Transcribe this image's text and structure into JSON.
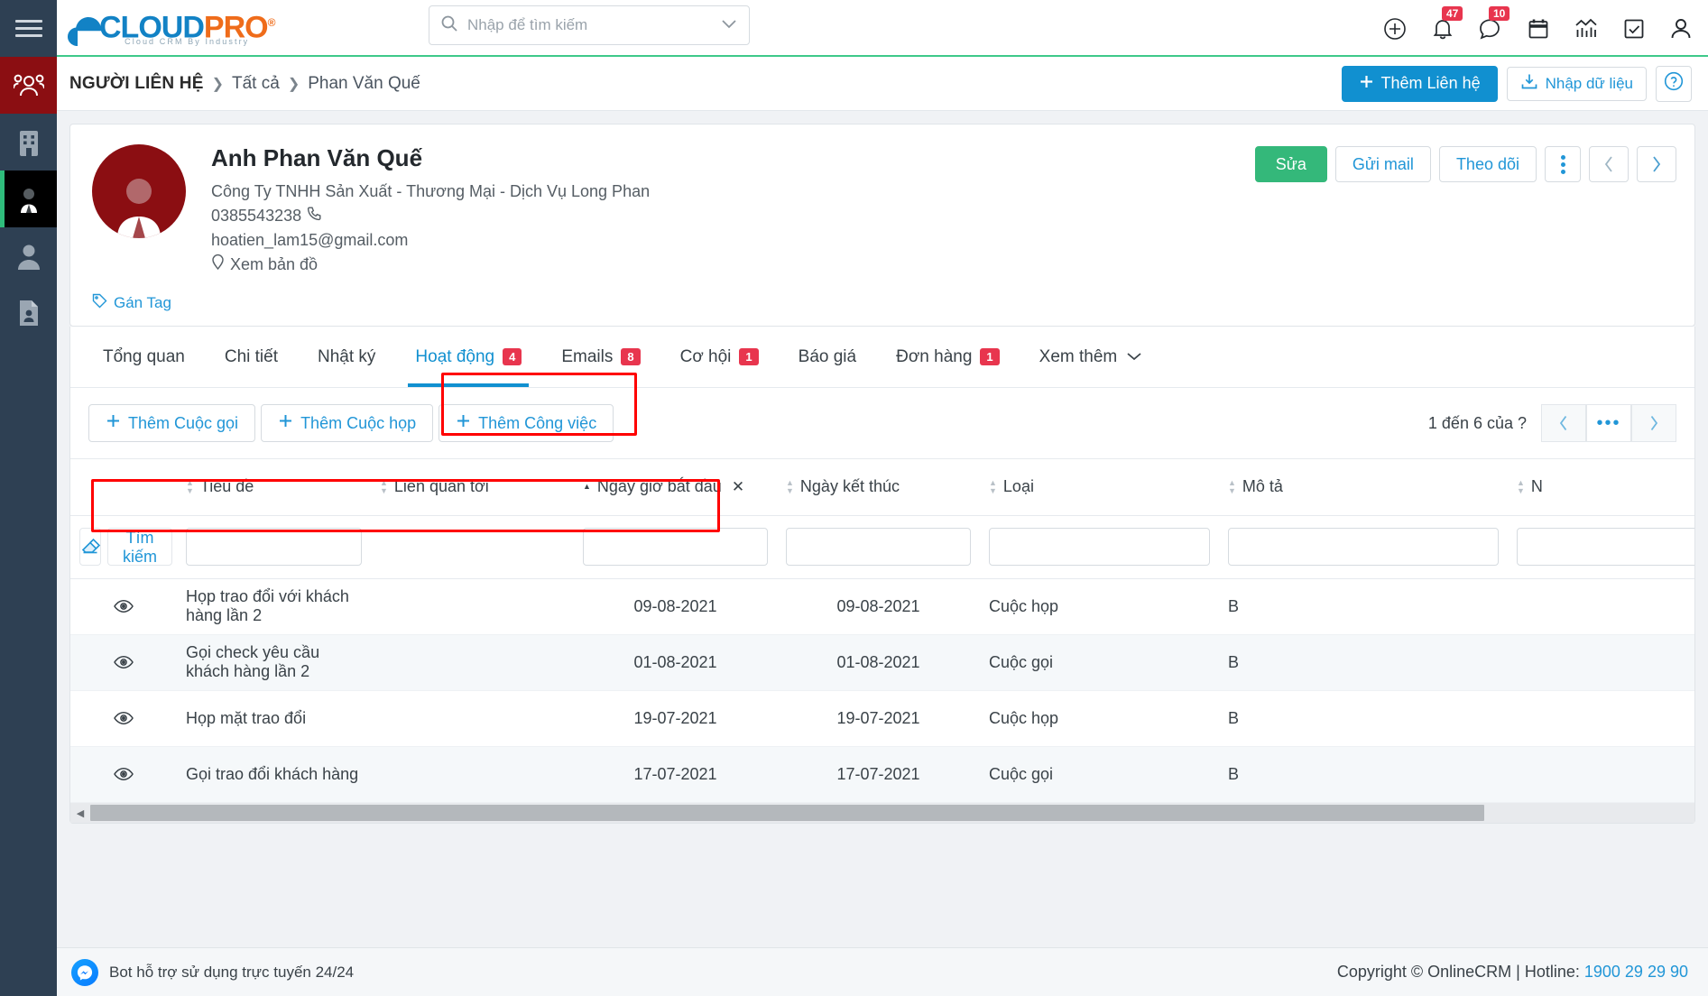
{
  "rail": {
    "menu_icon": "hamburger-menu-icon",
    "items": [
      {
        "name": "contacts",
        "icon": "people-group-icon",
        "state": "highlighted"
      },
      {
        "name": "companies",
        "icon": "building-icon",
        "state": "normal"
      },
      {
        "name": "persons",
        "icon": "businessman-icon",
        "state": "active"
      },
      {
        "name": "leads",
        "icon": "user-icon",
        "state": "normal"
      },
      {
        "name": "documents",
        "icon": "document-user-icon",
        "state": "normal"
      }
    ]
  },
  "topbar": {
    "logo": {
      "cloud": "CLOUD",
      "pro": "PRO",
      "registered": "®",
      "subtitle": "Cloud CRM By Industry"
    },
    "search": {
      "placeholder": "Nhập để tìm kiếm",
      "value": "",
      "icon": "search-icon",
      "dropdown_icon": "chevron-down-icon"
    },
    "icons": [
      {
        "name": "add-circle-icon",
        "badge": ""
      },
      {
        "name": "bell-icon",
        "badge": "47"
      },
      {
        "name": "chat-bubble-icon",
        "badge": "10"
      },
      {
        "name": "calendar-icon",
        "badge": ""
      },
      {
        "name": "analytics-chart-icon",
        "badge": ""
      },
      {
        "name": "checkbox-task-icon",
        "badge": ""
      },
      {
        "name": "user-account-icon",
        "badge": ""
      }
    ]
  },
  "breadcrumb": {
    "root": "NGƯỜI LIÊN HỆ",
    "separator": "❯",
    "all": "Tất cả",
    "current": "Phan Văn Quế",
    "add_contact": "Thêm Liên hệ",
    "import": "Nhập dữ liệu",
    "help": "?"
  },
  "contact": {
    "name": "Anh Phan Văn Quế",
    "company": "Công Ty TNHH Sản Xuất - Thương Mại - Dịch Vụ Long Phan",
    "phone": "0385543238",
    "email": "hoatien_lam15@gmail.com",
    "map_label": "Xem bản đồ",
    "tag_label": "Gán Tag",
    "actions": {
      "edit": "Sửa",
      "send_mail": "Gửi mail",
      "follow": "Theo dõi",
      "more": "more-vertical-icon",
      "prev": "‹",
      "next": "›"
    }
  },
  "tabs": [
    {
      "label": "Tổng quan",
      "badge": "",
      "active": false
    },
    {
      "label": "Chi tiết",
      "badge": "",
      "active": false
    },
    {
      "label": "Nhật ký",
      "badge": "",
      "active": false
    },
    {
      "label": "Hoạt động",
      "badge": "4",
      "active": true
    },
    {
      "label": "Emails",
      "badge": "8",
      "active": false
    },
    {
      "label": "Cơ hội",
      "badge": "1",
      "active": false
    },
    {
      "label": "Báo giá",
      "badge": "",
      "active": false
    },
    {
      "label": "Đơn hàng",
      "badge": "1",
      "active": false
    },
    {
      "label": "Xem thêm",
      "badge": "",
      "active": false
    }
  ],
  "toolbar": {
    "add_call": "Thêm Cuộc gọi",
    "add_meeting": "Thêm Cuộc họp",
    "add_task": "Thêm Công việc",
    "pager_label": "1 đến 6 của ?",
    "pager_prev": "‹",
    "pager_mid": "•••",
    "pager_next": "›"
  },
  "table": {
    "columns": [
      {
        "key": "eye",
        "label": "",
        "sortable": false
      },
      {
        "key": "title",
        "label": "Tiêu đề",
        "sortable": true,
        "sorted": ""
      },
      {
        "key": "related",
        "label": "Liên quan tới",
        "sortable": true,
        "sorted": ""
      },
      {
        "key": "start",
        "label": "Ngày giờ bắt đầu",
        "sortable": true,
        "sorted": "asc",
        "clearable": true
      },
      {
        "key": "end",
        "label": "Ngày kết thúc",
        "sortable": true,
        "sorted": ""
      },
      {
        "key": "type",
        "label": "Loại",
        "sortable": true,
        "sorted": ""
      },
      {
        "key": "desc",
        "label": "Mô tả",
        "sortable": true,
        "sorted": ""
      },
      {
        "key": "more",
        "label": "N",
        "sortable": true,
        "sorted": ""
      }
    ],
    "filter": {
      "eraser_icon": "eraser-icon",
      "search_button": "Tìm kiếm",
      "title_value": "",
      "start_value": "",
      "end_value": "",
      "type_value": "",
      "desc_value": "",
      "more_value": ""
    },
    "rows": [
      {
        "eye": "eye-icon",
        "title": "Họp trao đổi với khách hàng lần 2",
        "related": "",
        "start": "09-08-2021",
        "end": "09-08-2021",
        "type": "Cuộc họp",
        "desc": "B"
      },
      {
        "eye": "eye-icon",
        "title": "Gọi check yêu cầu khách hàng lần 2",
        "related": "",
        "start": "01-08-2021",
        "end": "01-08-2021",
        "type": "Cuộc gọi",
        "desc": "B"
      },
      {
        "eye": "eye-icon",
        "title": "Họp mặt trao đổi",
        "related": "",
        "start": "19-07-2021",
        "end": "19-07-2021",
        "type": "Cuộc họp",
        "desc": "B"
      },
      {
        "eye": "eye-icon",
        "title": "Gọi trao đổi khách hàng",
        "related": "",
        "start": "17-07-2021",
        "end": "17-07-2021",
        "type": "Cuộc gọi",
        "desc": "B"
      }
    ]
  },
  "footer": {
    "bot_label": "Bot hỗ trợ sử dụng trực tuyến 24/24",
    "copyright": "Copyright © OnlineCRM | Hotline: ",
    "hotline": "1900 29 29 90"
  },
  "colors": {
    "accent_blue": "#1190d0",
    "green": "#34b87a",
    "badge_red": "#e8354e",
    "rail_dark": "#2e4053",
    "rail_red": "#8b0e12",
    "highlight_red": "#ff0000"
  }
}
